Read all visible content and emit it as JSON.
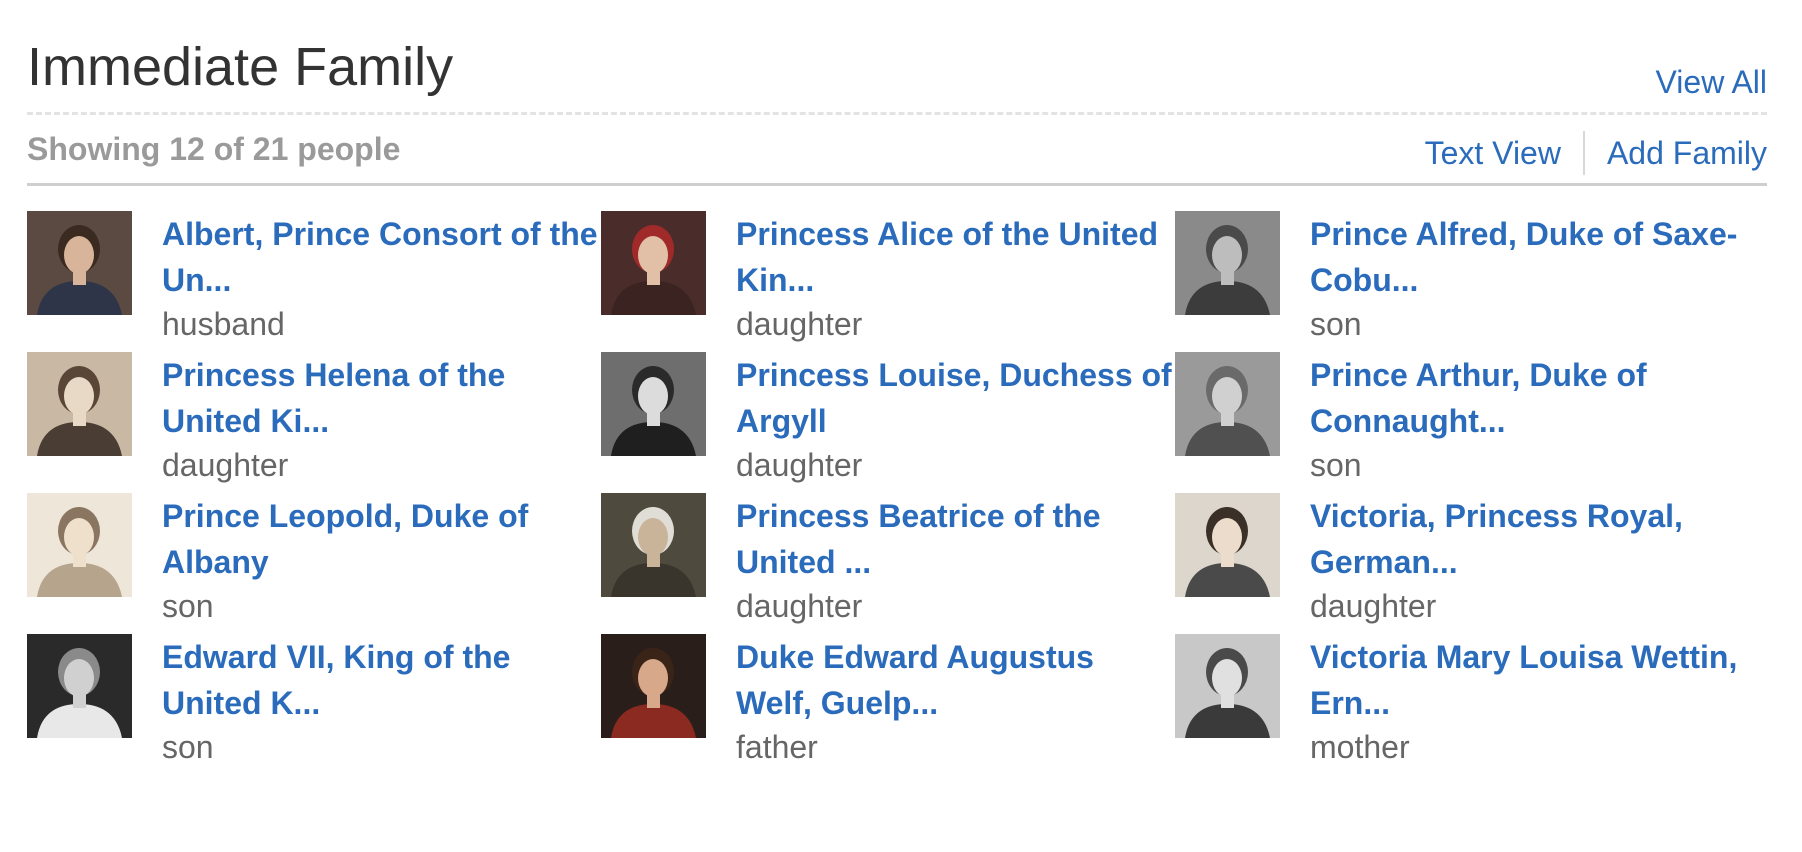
{
  "header": {
    "title": "Immediate Family",
    "view_all": "View All"
  },
  "subheader": {
    "showing": "Showing 12 of 21 people",
    "text_view": "Text View",
    "add_family": "Add Family"
  },
  "people": [
    {
      "name": "Albert, Prince Consort of the Un...",
      "relation": "husband",
      "photo": {
        "bg": "#5a4a42",
        "fg": "#2f3548",
        "face": "#d7b49a",
        "hair": "#3b2a20"
      }
    },
    {
      "name": "Princess Alice of the United Kin...",
      "relation": "daughter",
      "photo": {
        "bg": "#4a2d2a",
        "fg": "#3a2320",
        "face": "#e2c0a8",
        "hair": "#a02a2a"
      }
    },
    {
      "name": "Prince Alfred, Duke of Saxe-Cobu...",
      "relation": "son",
      "photo": {
        "bg": "#8a8a8a",
        "fg": "#3c3c3c",
        "face": "#bdbdbd",
        "hair": "#4a4a4a"
      }
    },
    {
      "name": "Princess Helena of the United Ki...",
      "relation": "daughter",
      "photo": {
        "bg": "#c9b8a4",
        "fg": "#4a3d33",
        "face": "#e8d8c6",
        "hair": "#5a4636"
      }
    },
    {
      "name": "Princess Louise, Duchess of Argyll",
      "relation": "daughter",
      "photo": {
        "bg": "#6e6e6e",
        "fg": "#1f1f1f",
        "face": "#dcdcdc",
        "hair": "#2a2a2a"
      }
    },
    {
      "name": "Prince Arthur, Duke of Connaught...",
      "relation": "son",
      "photo": {
        "bg": "#9a9a9a",
        "fg": "#505050",
        "face": "#d0d0d0",
        "hair": "#6a6a6a"
      }
    },
    {
      "name": "Prince Leopold, Duke of Albany",
      "relation": "son",
      "photo": {
        "bg": "#efe6da",
        "fg": "#b6a48c",
        "face": "#efe0cc",
        "hair": "#8a7660"
      }
    },
    {
      "name": "Princess Beatrice of the United ...",
      "relation": "daughter",
      "photo": {
        "bg": "#4f4a3e",
        "fg": "#3a352c",
        "face": "#c9b49a",
        "hair": "#e0ddd6"
      }
    },
    {
      "name": "Victoria, Princess Royal, German...",
      "relation": "daughter",
      "photo": {
        "bg": "#ddd6cc",
        "fg": "#4a4a4a",
        "face": "#ecdccb",
        "hair": "#3a3028"
      }
    },
    {
      "name": "Edward VII, King of the United K...",
      "relation": "son",
      "photo": {
        "bg": "#2a2a2a",
        "fg": "#e8e8e8",
        "face": "#d0d0d0",
        "hair": "#8a8a8a"
      }
    },
    {
      "name": "Duke Edward Augustus Welf, Guelp...",
      "relation": "father",
      "photo": {
        "bg": "#2a1e1a",
        "fg": "#8a2a20",
        "face": "#d8a88a",
        "hair": "#3a2418"
      }
    },
    {
      "name": "Victoria Mary Louisa Wettin, Ern...",
      "relation": "mother",
      "photo": {
        "bg": "#c8c8c8",
        "fg": "#3a3a3a",
        "face": "#e0e0e0",
        "hair": "#4a4a4a"
      }
    }
  ]
}
